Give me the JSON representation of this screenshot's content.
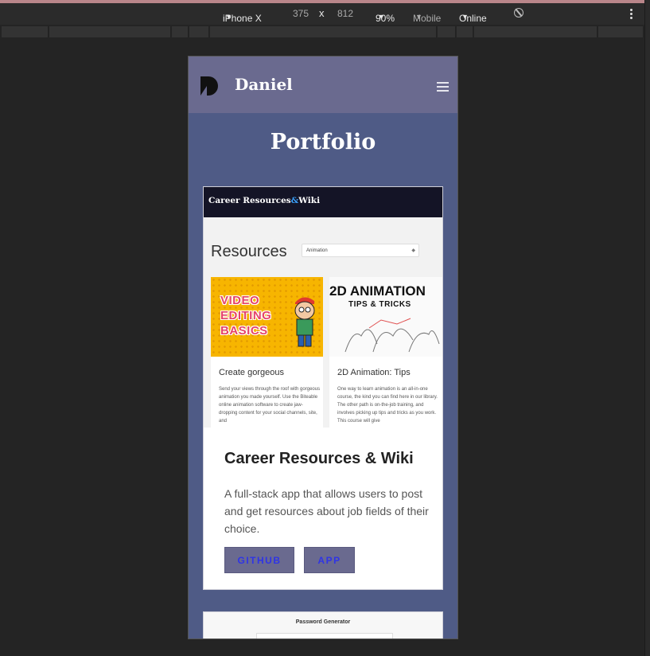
{
  "devtools": {
    "device": "iPhone X",
    "width": "375",
    "times": "x",
    "height": "812",
    "zoom": "90%",
    "throttle_label": "Mobile",
    "network": "Online",
    "rotate_icon": "rotate-icon",
    "more_icon": "kebab-icon"
  },
  "site": {
    "brand": "Daniel",
    "logo_icon": "d-logo-icon",
    "menu_icon": "hamburger-icon",
    "page_title": "Portfolio",
    "colors": {
      "nav": "#6a6a8f",
      "background": "#4f5b86",
      "button_text": "#2f34e6"
    }
  },
  "project": {
    "screenshot": {
      "header_title": "Career Resources",
      "header_amp": "&",
      "header_title2": "Wiki",
      "resources_label": "Resources",
      "select_value": "Animation",
      "card1": {
        "image_text": "VIDEO EDITING BASICS",
        "title": "Create gorgeous",
        "body": "Send your views through the roof with gorgeous animation you made yourself. Use the Biteable online animation software to create jaw-dropping content for your social channels, site, and"
      },
      "card2": {
        "image_title": "2D ANIMATION",
        "image_subtitle": "TIPS & TRICKS",
        "title": "2D Animation: Tips",
        "body": "One way to learn animation is an all-in-one course, the kind you can find here in our library. The other path is on-the-job training, and involves picking up tips and tricks as you work. This course will give"
      }
    },
    "title": "Career Resources & Wiki",
    "description": "A full-stack app that allows users to post and get resources about job fields of their choice.",
    "buttons": {
      "github": "GITHUB",
      "app": "APP"
    }
  },
  "next_project": {
    "title": "Password Generator"
  }
}
